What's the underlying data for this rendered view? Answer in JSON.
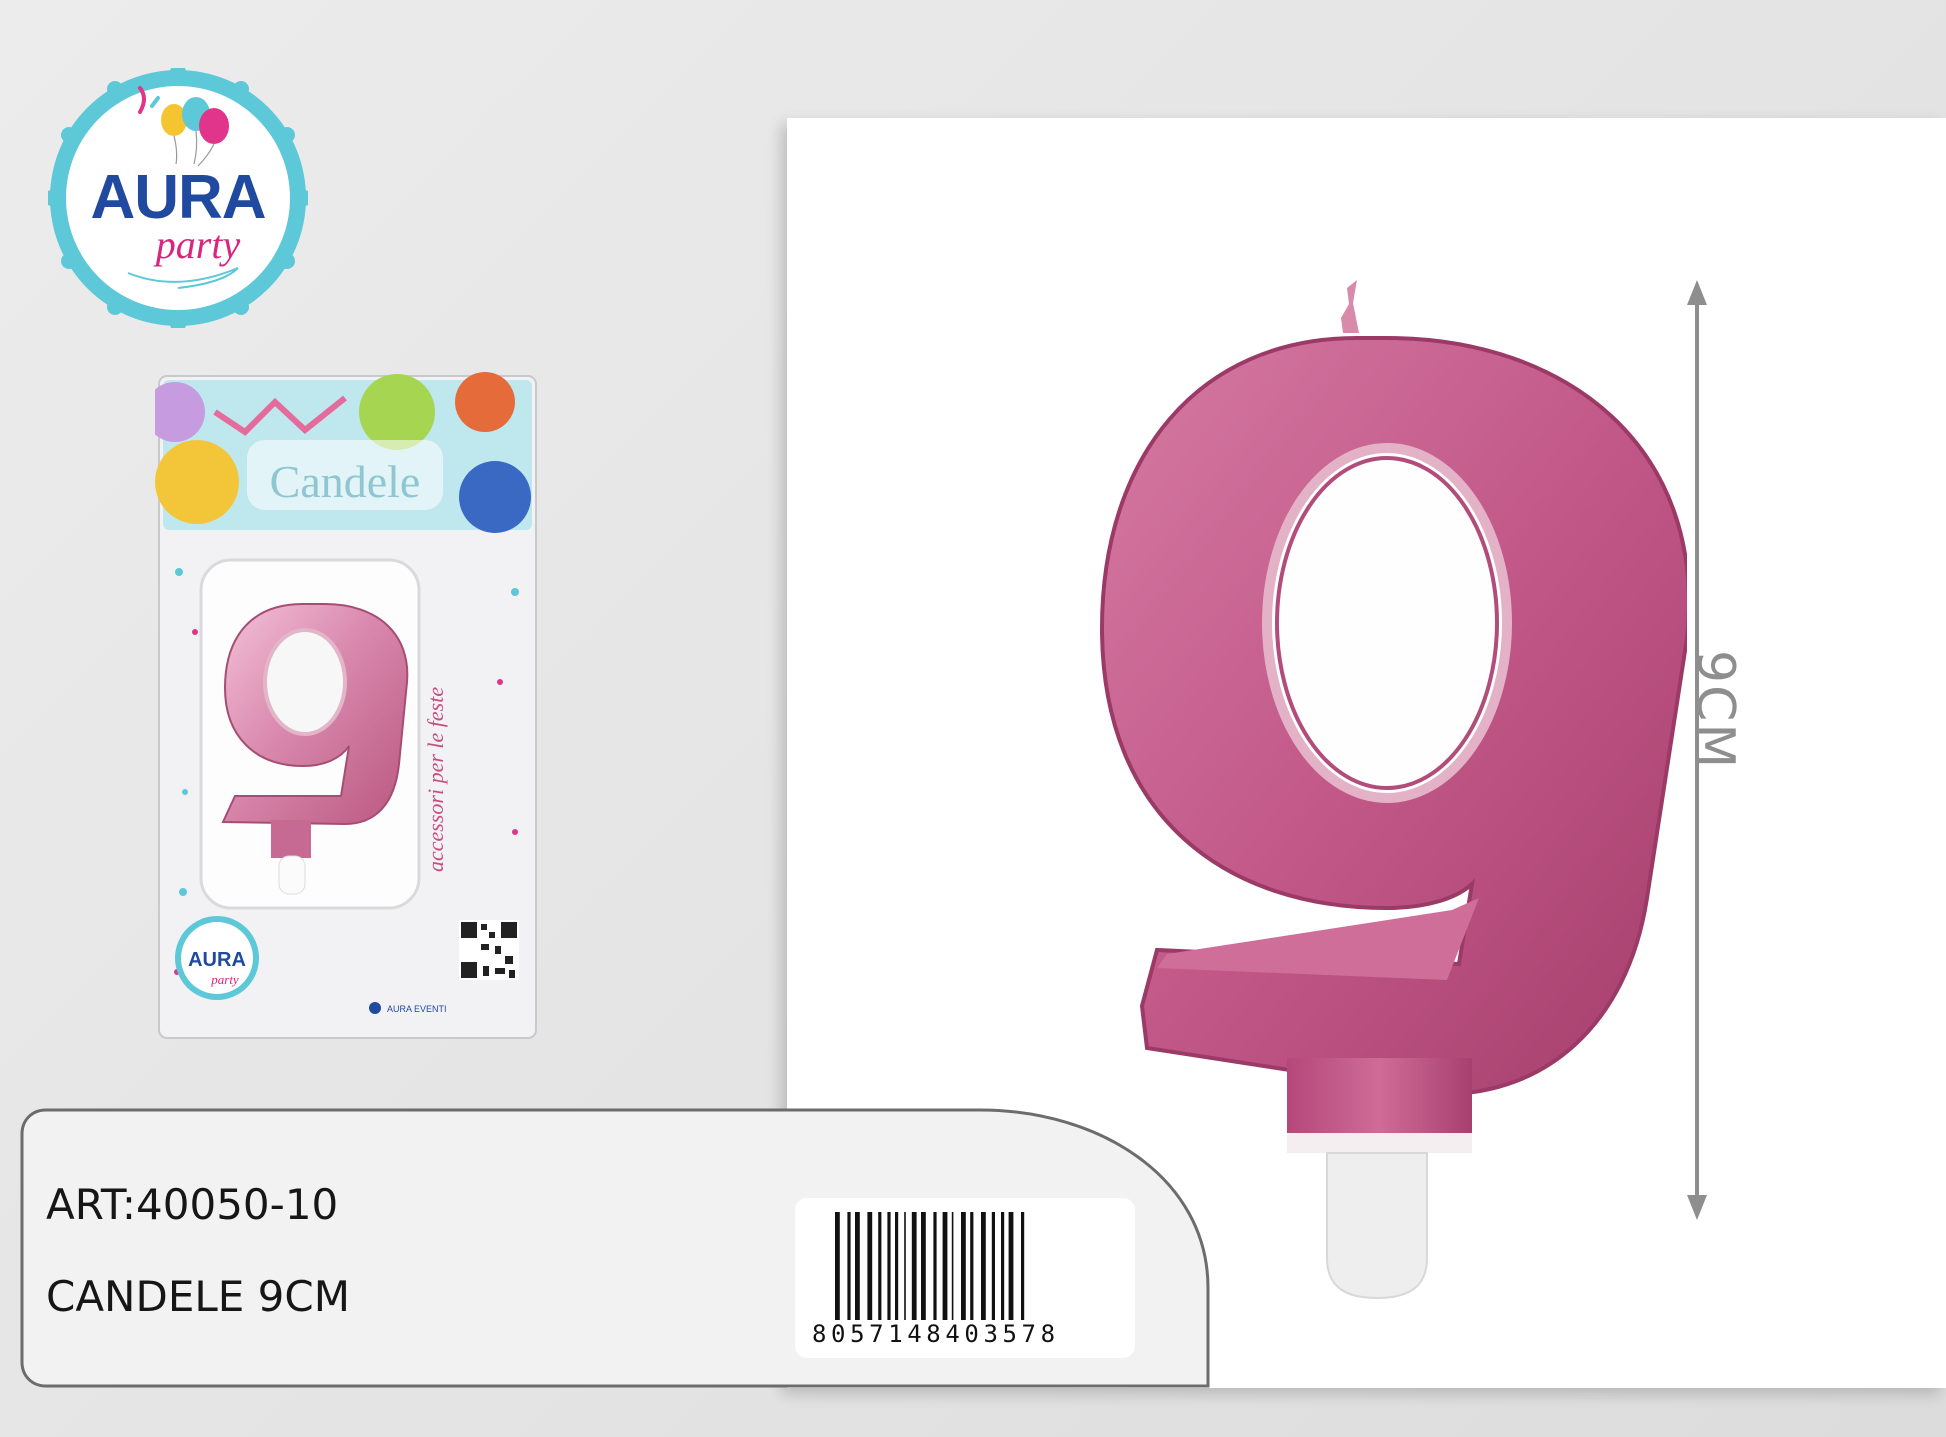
{
  "logo": {
    "brand": "AURA",
    "tagline": "party"
  },
  "package": {
    "header_title": "Candele",
    "side_text": "accessori per le feste",
    "brand": "AURA",
    "tagline": "party",
    "social": "AURA EVENTI",
    "candle_digit": "9"
  },
  "product": {
    "candle_digit": "9",
    "height_label": "9CM"
  },
  "info": {
    "article": "ART:40050-10",
    "name": "CANDELE 9CM"
  },
  "barcode": {
    "number": "8057148403578"
  },
  "colors": {
    "candle_pink": "#c0517f",
    "logo_blue": "#1f4aa0",
    "logo_pink": "#d9257e",
    "logo_ring": "#5cc8d8"
  }
}
